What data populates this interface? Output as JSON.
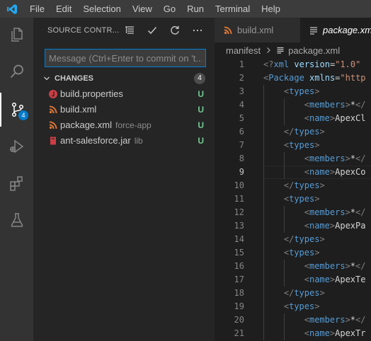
{
  "colors": {
    "accent": "#007acc",
    "focus_border": "#007fd4",
    "untracked": "#73c991",
    "xml_icon": "#e37933",
    "properties_icon": "#cc3e44",
    "tag": "#569cd6",
    "attr": "#9cdcfe",
    "string": "#ce9178"
  },
  "menu": [
    "File",
    "Edit",
    "Selection",
    "View",
    "Go",
    "Run",
    "Terminal",
    "Help"
  ],
  "activity": {
    "items": [
      {
        "icon": "explorer-icon"
      },
      {
        "icon": "search-icon"
      },
      {
        "icon": "source-control-icon",
        "badge": "4"
      },
      {
        "icon": "run-debug-icon"
      },
      {
        "icon": "extensions-icon"
      },
      {
        "icon": "testing-flask-icon"
      }
    ]
  },
  "sidebar": {
    "title": "SOURCE CONTR...",
    "actions": [
      {
        "icon": "view-as-tree-icon"
      },
      {
        "icon": "commit-check-icon"
      },
      {
        "icon": "refresh-icon"
      },
      {
        "icon": "more-actions-icon"
      }
    ],
    "commit_placeholder": "Message (Ctrl+Enter to commit on 't...",
    "changes": {
      "title": "CHANGES",
      "count": "4",
      "files": [
        {
          "name": "build.properties",
          "desc": "",
          "status": "U",
          "icon": "properties-file-icon"
        },
        {
          "name": "build.xml",
          "desc": "",
          "status": "U",
          "icon": "xml-file-icon"
        },
        {
          "name": "package.xml",
          "desc": "force-app",
          "status": "U",
          "icon": "xml-file-icon"
        },
        {
          "name": "ant-salesforce.jar",
          "desc": "lib",
          "status": "U",
          "icon": "jar-file-icon"
        }
      ]
    }
  },
  "editor": {
    "tabs": [
      {
        "label": "build.xml",
        "active": false
      },
      {
        "label": "package.xml",
        "active": true
      }
    ],
    "breadcrumb": {
      "folder": "manifest",
      "file": "package.xml"
    },
    "current_line": 9,
    "lines": [
      {
        "n": "1",
        "indent": 0,
        "parts": [
          [
            "punct",
            "<?"
          ],
          [
            "tag",
            "xml"
          ],
          [
            "text",
            " "
          ],
          [
            "attr",
            "version"
          ],
          [
            "text",
            "="
          ],
          [
            "str",
            "\"1.0\""
          ],
          [
            "text",
            " "
          ]
        ]
      },
      {
        "n": "2",
        "indent": 0,
        "parts": [
          [
            "punct",
            "<"
          ],
          [
            "tag",
            "Package"
          ],
          [
            "text",
            " "
          ],
          [
            "attr",
            "xmlns"
          ],
          [
            "text",
            "="
          ],
          [
            "str",
            "\"http"
          ]
        ]
      },
      {
        "n": "3",
        "indent": 1,
        "parts": [
          [
            "punct",
            "<"
          ],
          [
            "tag",
            "types"
          ],
          [
            "punct",
            ">"
          ]
        ]
      },
      {
        "n": "4",
        "indent": 2,
        "parts": [
          [
            "punct",
            "<"
          ],
          [
            "tag",
            "members"
          ],
          [
            "punct",
            ">"
          ],
          [
            "text",
            "*"
          ],
          [
            "punct",
            "</"
          ]
        ]
      },
      {
        "n": "5",
        "indent": 2,
        "parts": [
          [
            "punct",
            "<"
          ],
          [
            "tag",
            "name"
          ],
          [
            "punct",
            ">"
          ],
          [
            "text",
            "ApexCl"
          ]
        ]
      },
      {
        "n": "6",
        "indent": 1,
        "parts": [
          [
            "punct",
            "</"
          ],
          [
            "tag",
            "types"
          ],
          [
            "punct",
            ">"
          ]
        ]
      },
      {
        "n": "7",
        "indent": 1,
        "parts": [
          [
            "punct",
            "<"
          ],
          [
            "tag",
            "types"
          ],
          [
            "punct",
            ">"
          ]
        ]
      },
      {
        "n": "8",
        "indent": 2,
        "parts": [
          [
            "punct",
            "<"
          ],
          [
            "tag",
            "members"
          ],
          [
            "punct",
            ">"
          ],
          [
            "text",
            "*"
          ],
          [
            "punct",
            "</"
          ]
        ]
      },
      {
        "n": "9",
        "indent": 2,
        "parts": [
          [
            "punct",
            "<"
          ],
          [
            "tag",
            "name"
          ],
          [
            "punct",
            ">"
          ],
          [
            "text",
            "ApexCo"
          ]
        ]
      },
      {
        "n": "10",
        "indent": 1,
        "parts": [
          [
            "punct",
            "</"
          ],
          [
            "tag",
            "types"
          ],
          [
            "punct",
            ">"
          ]
        ]
      },
      {
        "n": "11",
        "indent": 1,
        "parts": [
          [
            "punct",
            "<"
          ],
          [
            "tag",
            "types"
          ],
          [
            "punct",
            ">"
          ]
        ]
      },
      {
        "n": "12",
        "indent": 2,
        "parts": [
          [
            "punct",
            "<"
          ],
          [
            "tag",
            "members"
          ],
          [
            "punct",
            ">"
          ],
          [
            "text",
            "*"
          ],
          [
            "punct",
            "</"
          ]
        ]
      },
      {
        "n": "13",
        "indent": 2,
        "parts": [
          [
            "punct",
            "<"
          ],
          [
            "tag",
            "name"
          ],
          [
            "punct",
            ">"
          ],
          [
            "text",
            "ApexPa"
          ]
        ]
      },
      {
        "n": "14",
        "indent": 1,
        "parts": [
          [
            "punct",
            "</"
          ],
          [
            "tag",
            "types"
          ],
          [
            "punct",
            ">"
          ]
        ]
      },
      {
        "n": "15",
        "indent": 1,
        "parts": [
          [
            "punct",
            "<"
          ],
          [
            "tag",
            "types"
          ],
          [
            "punct",
            ">"
          ]
        ]
      },
      {
        "n": "16",
        "indent": 2,
        "parts": [
          [
            "punct",
            "<"
          ],
          [
            "tag",
            "members"
          ],
          [
            "punct",
            ">"
          ],
          [
            "text",
            "*"
          ],
          [
            "punct",
            "</"
          ]
        ]
      },
      {
        "n": "17",
        "indent": 2,
        "parts": [
          [
            "punct",
            "<"
          ],
          [
            "tag",
            "name"
          ],
          [
            "punct",
            ">"
          ],
          [
            "text",
            "ApexTe"
          ]
        ]
      },
      {
        "n": "18",
        "indent": 1,
        "parts": [
          [
            "punct",
            "</"
          ],
          [
            "tag",
            "types"
          ],
          [
            "punct",
            ">"
          ]
        ]
      },
      {
        "n": "19",
        "indent": 1,
        "parts": [
          [
            "punct",
            "<"
          ],
          [
            "tag",
            "types"
          ],
          [
            "punct",
            ">"
          ]
        ]
      },
      {
        "n": "20",
        "indent": 2,
        "parts": [
          [
            "punct",
            "<"
          ],
          [
            "tag",
            "members"
          ],
          [
            "punct",
            ">"
          ],
          [
            "text",
            "*"
          ],
          [
            "punct",
            "</"
          ]
        ]
      },
      {
        "n": "21",
        "indent": 2,
        "parts": [
          [
            "punct",
            "<"
          ],
          [
            "tag",
            "name"
          ],
          [
            "punct",
            ">"
          ],
          [
            "text",
            "ApexTr"
          ]
        ]
      }
    ]
  }
}
